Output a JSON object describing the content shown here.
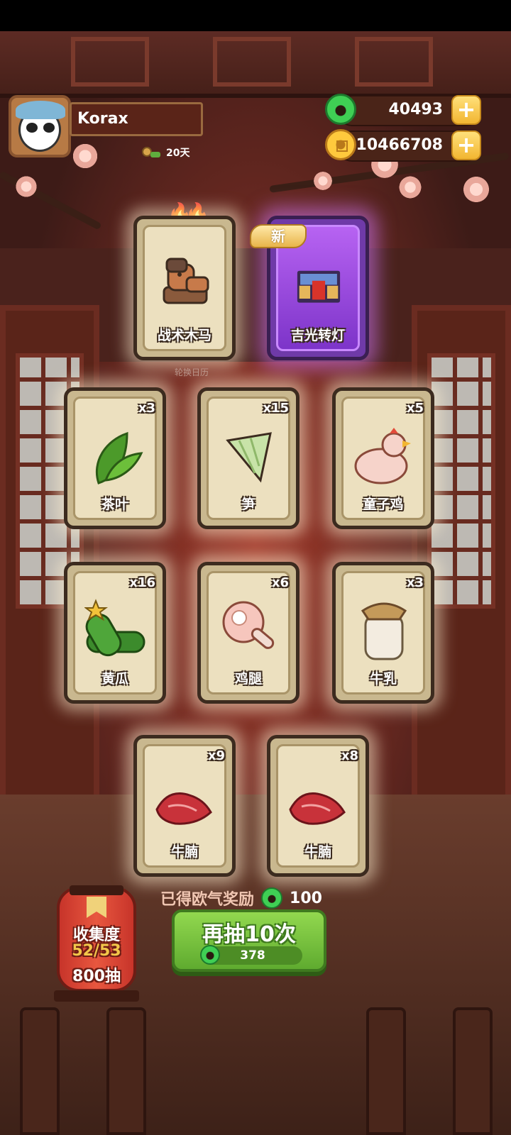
{
  "player": {
    "name": "Korax",
    "days": "20天"
  },
  "currency": {
    "jade": "40493",
    "coins": "10466708"
  },
  "featured": [
    {
      "label": "战术木马",
      "icon": "wooden-horse-icon"
    },
    {
      "label": "吉光转灯",
      "icon": "lantern-scene-icon",
      "badge": "新"
    }
  ],
  "featured_caption": "轮换日历",
  "items": [
    {
      "label": "茶叶",
      "count": "x3",
      "icon": "tea-leaf-icon",
      "color": "#4c9a2a"
    },
    {
      "label": "笋",
      "count": "x15",
      "icon": "bamboo-shoot-icon",
      "color": "#b8d99a"
    },
    {
      "label": "童子鸡",
      "count": "x5",
      "icon": "chicken-icon",
      "color": "#f2c2b8"
    },
    {
      "label": "黄瓜",
      "count": "x16",
      "icon": "cucumber-icon",
      "color": "#3c8b2c"
    },
    {
      "label": "鸡腿",
      "count": "x6",
      "icon": "drumstick-icon",
      "color": "#f0b9b0"
    },
    {
      "label": "牛乳",
      "count": "x3",
      "icon": "milk-jar-icon",
      "color": "#e9e0cf"
    },
    {
      "label": "牛腩",
      "count": "x9",
      "icon": "beef-icon",
      "color": "#c8323a"
    },
    {
      "label": "牛腩",
      "count": "x8",
      "icon": "beef-icon",
      "color": "#c8323a"
    }
  ],
  "reward": {
    "label": "已得欧气奖励",
    "value": "100"
  },
  "draw": {
    "label": "再抽10次",
    "cost": "378"
  },
  "collection": {
    "title": "收集度",
    "progress": "52/53",
    "draws": "800抽"
  }
}
